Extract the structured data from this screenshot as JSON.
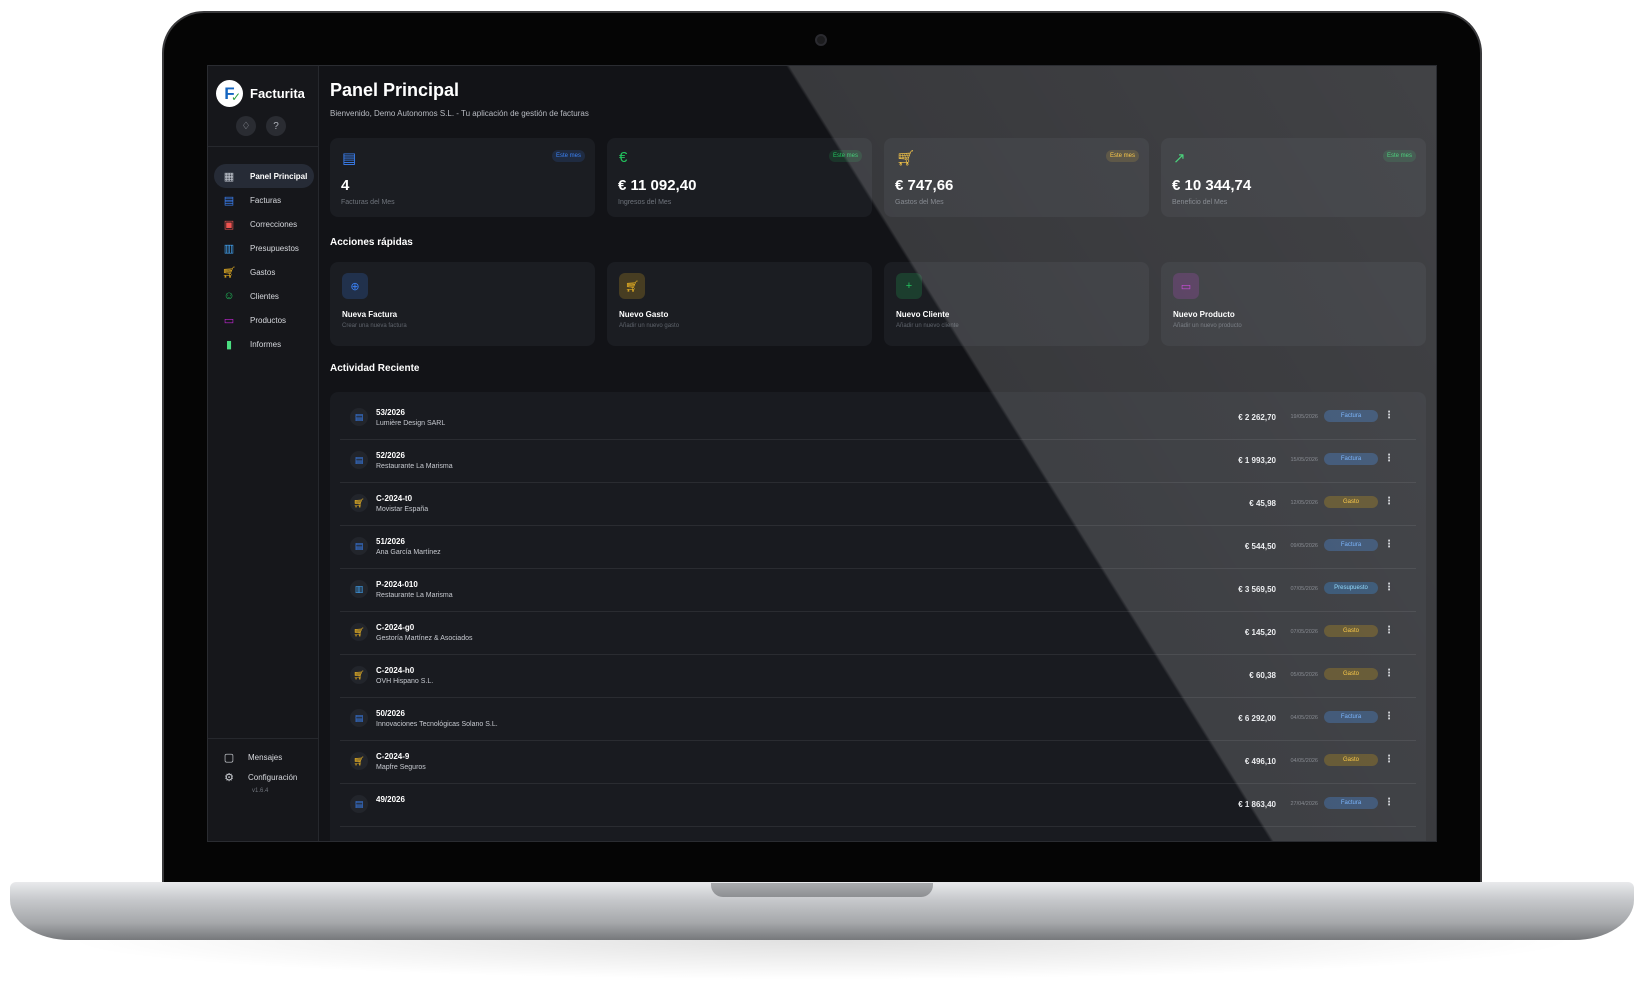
{
  "app": {
    "name": "Facturita",
    "version": "v1.6.4"
  },
  "sidebar": {
    "items": [
      {
        "label": "Panel Principal",
        "icon": "dashboard-icon",
        "color": "#c5cad3",
        "active": true
      },
      {
        "label": "Facturas",
        "icon": "invoice-icon",
        "color": "#3b82f6",
        "active": false
      },
      {
        "label": "Correcciones",
        "icon": "corrections-icon",
        "color": "#ef5350",
        "active": false
      },
      {
        "label": "Presupuestos",
        "icon": "quote-icon",
        "color": "#42a5f5",
        "active": false
      },
      {
        "label": "Gastos",
        "icon": "cart-icon",
        "color": "#fbbf24",
        "active": false
      },
      {
        "label": "Clientes",
        "icon": "people-icon",
        "color": "#22c55e",
        "active": false
      },
      {
        "label": "Productos",
        "icon": "box-icon",
        "color": "#c026d3",
        "active": false
      },
      {
        "label": "Informes",
        "icon": "bar-chart-icon",
        "color": "#4ade80",
        "active": false
      }
    ],
    "bottom": [
      {
        "label": "Mensajes",
        "icon": "messages-icon"
      },
      {
        "label": "Configuración",
        "icon": "gear-icon"
      }
    ]
  },
  "header": {
    "title": "Panel Principal",
    "subtitle": "Bienvenido, Demo Autonomos S.L. - Tu aplicación de gestión de facturas"
  },
  "stats": [
    {
      "value": "4",
      "label": "Facturas del Mes",
      "badge": "Este mes",
      "icon": "document-icon",
      "color": "#3b82f6"
    },
    {
      "value": "€ 11 092,40",
      "label": "Ingresos del Mes",
      "badge": "Este mes",
      "icon": "euro-icon",
      "color": "#22c55e"
    },
    {
      "value": "€ 747,66",
      "label": "Gastos del Mes",
      "badge": "Este mes",
      "icon": "cart-icon",
      "color": "#fbbf24"
    },
    {
      "value": "€ 10 344,74",
      "label": "Beneficio del Mes",
      "badge": "Este mes",
      "icon": "trending-up-icon",
      "color": "#22c55e"
    }
  ],
  "quick_actions": {
    "title": "Acciones rápidas",
    "items": [
      {
        "title": "Nueva Factura",
        "subtitle": "Crear una nueva factura",
        "icon": "add-circle-icon",
        "color": "#3b82f6"
      },
      {
        "title": "Nuevo Gasto",
        "subtitle": "Añadir un nuevo gasto",
        "icon": "cart-icon",
        "color": "#fbbf24"
      },
      {
        "title": "Nuevo Cliente",
        "subtitle": "Añadir un nuevo cliente",
        "icon": "add-person-icon",
        "color": "#22c55e"
      },
      {
        "title": "Nuevo Producto",
        "subtitle": "Añadir un nuevo producto",
        "icon": "box-icon",
        "color": "#c026d3"
      }
    ]
  },
  "activity": {
    "title": "Actividad Reciente",
    "rows": [
      {
        "id": "53/2026",
        "client": "Lumière Design SARL",
        "amount": "€ 2 262,70",
        "date": "19/05/2026",
        "type": "Factura",
        "icon": "invoice-icon"
      },
      {
        "id": "52/2026",
        "client": "Restaurante La Marisma",
        "amount": "€ 1 993,20",
        "date": "15/05/2026",
        "type": "Factura",
        "icon": "invoice-icon"
      },
      {
        "id": "C-2024-t0",
        "client": "Movistar España",
        "amount": "€ 45,98",
        "date": "12/05/2026",
        "type": "Gasto",
        "icon": "cart-icon"
      },
      {
        "id": "51/2026",
        "client": "Ana García Martínez",
        "amount": "€ 544,50",
        "date": "09/05/2026",
        "type": "Factura",
        "icon": "invoice-icon"
      },
      {
        "id": "P-2024-010",
        "client": "Restaurante La Marisma",
        "amount": "€ 3 569,50",
        "date": "07/05/2026",
        "type": "Presupuesto",
        "icon": "quote-icon"
      },
      {
        "id": "C-2024-g0",
        "client": "Gestoría Martínez & Asociados",
        "amount": "€ 145,20",
        "date": "07/05/2026",
        "type": "Gasto",
        "icon": "cart-icon"
      },
      {
        "id": "C-2024-h0",
        "client": "OVH Hispano S.L.",
        "amount": "€ 60,38",
        "date": "05/05/2026",
        "type": "Gasto",
        "icon": "cart-icon"
      },
      {
        "id": "50/2026",
        "client": "Innovaciones Tecnológicas Solano S.L.",
        "amount": "€ 6 292,00",
        "date": "04/05/2026",
        "type": "Factura",
        "icon": "invoice-icon"
      },
      {
        "id": "C-2024-9",
        "client": "Mapfre Seguros",
        "amount": "€ 496,10",
        "date": "04/05/2026",
        "type": "Gasto",
        "icon": "cart-icon"
      },
      {
        "id": "49/2026",
        "client": "",
        "amount": "€ 1 863,40",
        "date": "27/04/2026",
        "type": "Factura",
        "icon": "invoice-icon"
      }
    ]
  },
  "colors": {
    "factura_badge_bg": "#1e3a5f",
    "factura_badge_fg": "#60a5fa",
    "gasto_badge_bg": "#4a3b10",
    "gasto_badge_fg": "#fbbf24",
    "presupuesto_badge_bg": "#173a5e",
    "presupuesto_badge_fg": "#7dd3fc"
  }
}
